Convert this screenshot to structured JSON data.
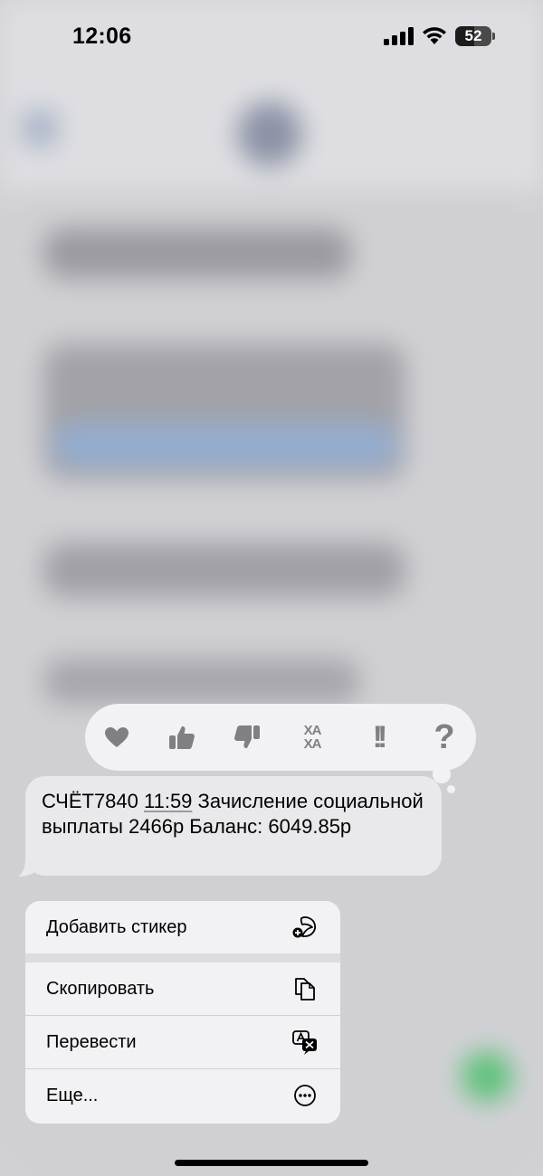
{
  "status_bar": {
    "time": "12:06",
    "battery": "52",
    "battery_level": 0.52
  },
  "reactions": [
    {
      "name": "heart-reaction",
      "icon": "heart-icon"
    },
    {
      "name": "thumbs-up-reaction",
      "icon": "thumbs-up-icon"
    },
    {
      "name": "thumbs-down-reaction",
      "icon": "thumbs-down-icon"
    },
    {
      "name": "haha-reaction",
      "icon": "haha-icon",
      "text_top": "ХА",
      "text_bottom": "ХА"
    },
    {
      "name": "exclamation-reaction",
      "icon": "double-exclamation-icon",
      "text": "!!"
    },
    {
      "name": "question-reaction",
      "icon": "question-icon",
      "text": "?"
    }
  ],
  "message": {
    "part1": "СЧЁТ7840 ",
    "time": "11:59",
    "part2": " Зачисление социальной выплаты 2466р Баланс: 6049.85р"
  },
  "menu": {
    "items": [
      {
        "label": "Добавить стикер",
        "icon": "sticker-add-icon"
      },
      {
        "label": "Скопировать",
        "icon": "copy-icon"
      },
      {
        "label": "Перевести",
        "icon": "translate-icon"
      },
      {
        "label": "Еще...",
        "icon": "more-icon"
      }
    ]
  },
  "colors": {
    "menu_bg": "#f2f2f4",
    "bubble_bg": "#e9e9eb",
    "reaction_icon": "#808084"
  }
}
